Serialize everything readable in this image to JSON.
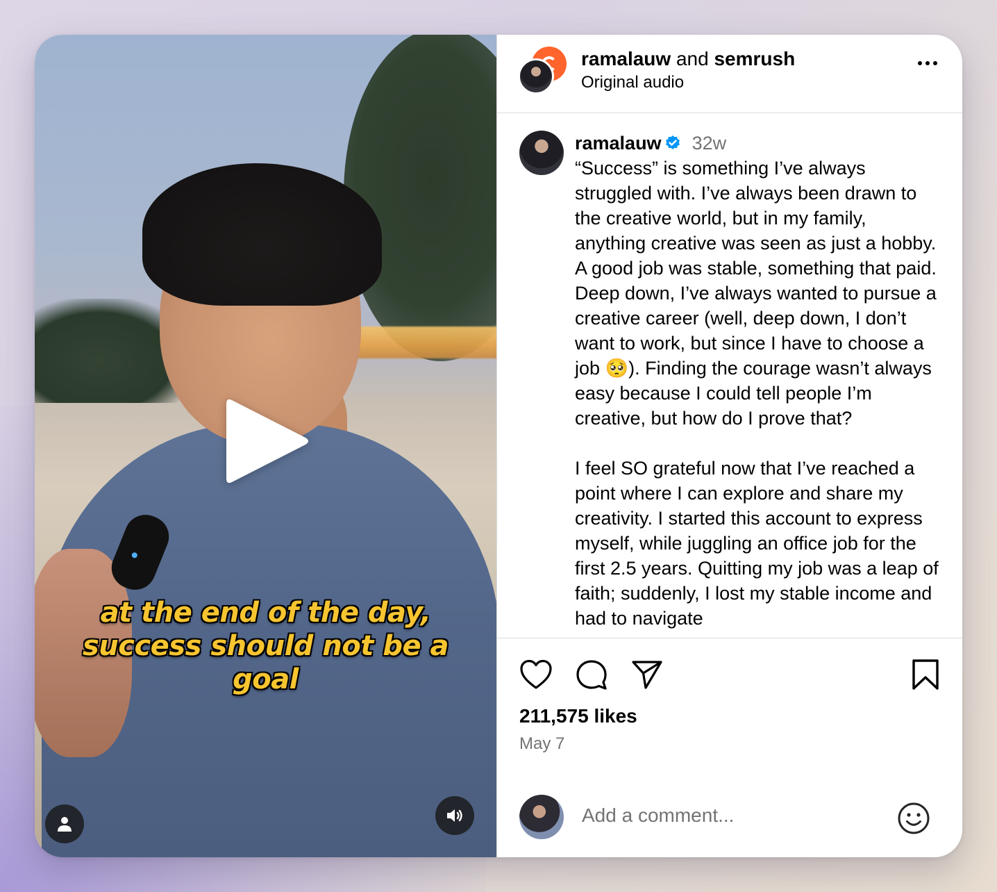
{
  "video": {
    "caption_lines": [
      "at the end of the day,",
      "success should not be a",
      "goal"
    ],
    "play_icon": "play-icon",
    "tag_icon": "person-icon",
    "mute_icon": "speaker-icon"
  },
  "header": {
    "user1": "ramalauw",
    "conjunction": "and",
    "user2": "semrush",
    "audio": "Original audio",
    "more_icon": "more-icon"
  },
  "post": {
    "username": "ramalauw",
    "time": "32w",
    "paragraph1_a": "“Success” is something I’ve always struggled with. I’ve always been drawn to the creative world, but in my family, anything creative was seen as just a hobby. A good job was stable, something that paid. Deep down, I’ve always wanted to pursue a creative career (well, deep down, I don’t want to work, but since I have to choose a job ",
    "paragraph1_emoji": "🥺",
    "paragraph1_b": "). Finding the courage wasn’t always easy because I could tell people I’m creative, but how do I prove that?",
    "paragraph2": "I feel SO grateful now that I’ve reached a point where I can explore and share my creativity. I started this account to express myself, while juggling an office job for the first 2.5 years. Quitting my job was a leap of faith; suddenly, I lost my stable income and had to navigate"
  },
  "stats": {
    "likes": "211,575 likes",
    "date": "May 7"
  },
  "comment": {
    "placeholder": "Add a comment..."
  },
  "colors": {
    "verified": "#0095f6",
    "caption": "#f7c530",
    "secondary_text": "#737373"
  }
}
